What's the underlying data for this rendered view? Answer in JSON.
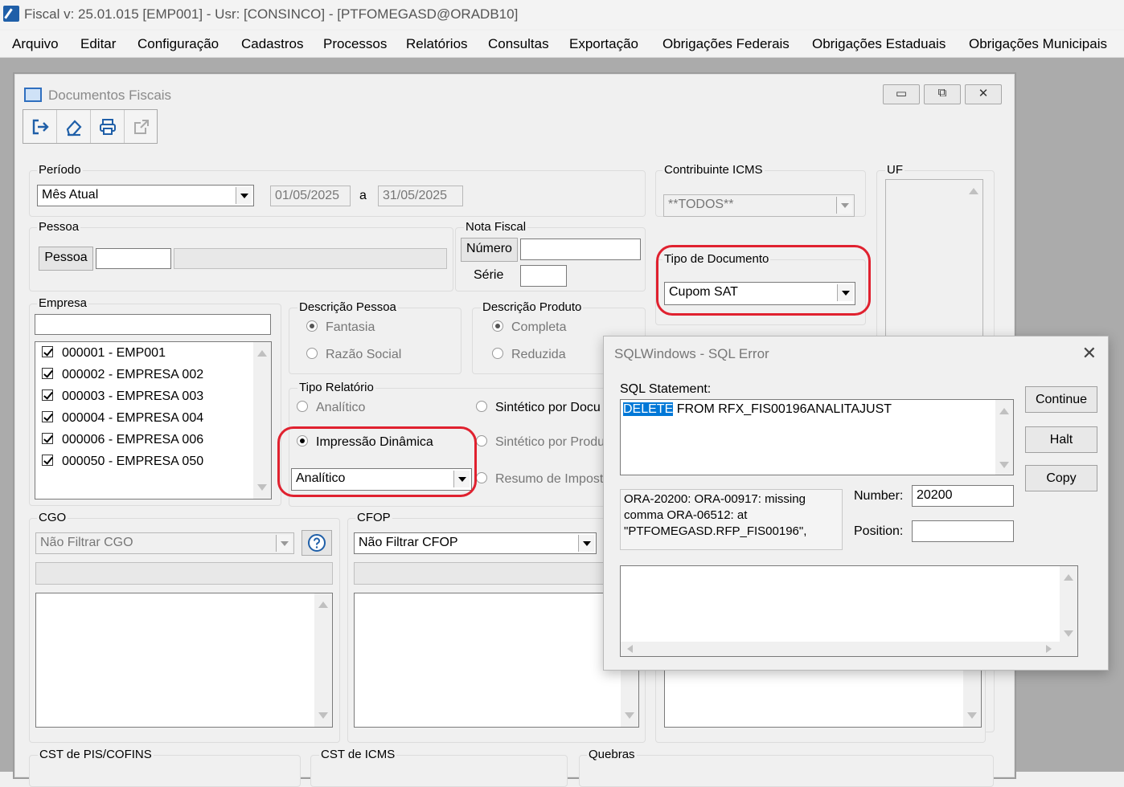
{
  "titlebar": {
    "title": "Fiscal  v: 25.01.015   [EMP001] - Usr: [CONSINCO] - [PTFOMEGASD@ORADB10]"
  },
  "menu": [
    "Arquivo",
    "Editar",
    "Configuração",
    "Cadastros",
    "Processos",
    "Relatórios",
    "Consultas",
    "Exportação",
    "Obrigações Federais",
    "Obrigações Estaduais",
    "Obrigações Municipais"
  ],
  "child_window": {
    "title": "Documentos Fiscais"
  },
  "periodo": {
    "label": "Período",
    "select": "Mês Atual",
    "from": "01/05/2025",
    "sep": "a",
    "to": "31/05/2025"
  },
  "contribuinte": {
    "label": "Contribuinte ICMS",
    "value": "**TODOS**"
  },
  "uf": {
    "label": "UF"
  },
  "pessoa": {
    "label": "Pessoa",
    "button": "Pessoa"
  },
  "nota_fiscal": {
    "label": "Nota Fiscal",
    "numero_button": "Número",
    "serie_label": "Série"
  },
  "tipo_documento": {
    "label": "Tipo de Documento",
    "value": "Cupom SAT"
  },
  "empresa": {
    "label": "Empresa",
    "items": [
      "000001 - EMP001",
      "000002 - EMPRESA 002",
      "000003 - EMPRESA 003",
      "000004 - EMPRESA 004",
      "000006 - EMPRESA 006",
      "000050 - EMPRESA 050"
    ]
  },
  "descricao_pessoa": {
    "label": "Descrição Pessoa",
    "opt1": "Fantasia",
    "opt2": "Razão Social"
  },
  "descricao_produto": {
    "label": "Descrição Produto",
    "opt1": "Completa",
    "opt2": "Reduzida"
  },
  "tipo_relatorio": {
    "label": "Tipo Relatório",
    "analitico": "Analítico",
    "impressao": "Impressão Dinâmica",
    "impressao_select": "Analítico",
    "sint_doc": "Sintético por Docu",
    "sint_prod": "Sintético por Produ",
    "resumo": "Resumo de Impost"
  },
  "cgo": {
    "label": "CGO",
    "select": "Não Filtrar CGO"
  },
  "cfop": {
    "label": "CFOP",
    "select": "Não Filtrar CFOP"
  },
  "bottom": {
    "cst_pis": "CST de PIS/COFINS",
    "cst_icms": "CST de ICMS",
    "quebras": "Quebras"
  },
  "dialog": {
    "title": "SQLWindows - SQL Error",
    "sql_label": "SQL Statement:",
    "sql_keyword": "DELETE",
    "sql_rest": " FROM RFX_FIS00196ANALITAJUST",
    "error_line1": "ORA-20200: ORA-00917: missing",
    "error_line2": "comma ORA-06512: at",
    "error_line3": "\"PTFOMEGASD.RFP_FIS00196\",",
    "number_label": "Number:",
    "number_value": "20200",
    "position_label": "Position:",
    "position_value": "",
    "btn_continue": "Continue",
    "btn_halt": "Halt",
    "btn_copy": "Copy",
    "close_glyph": "✕"
  },
  "window_buttons": {
    "minimize": "▭",
    "restore": "⧉",
    "close": "✕"
  },
  "colors": {
    "highlight": "#e0212f",
    "selection": "#0078d7"
  }
}
